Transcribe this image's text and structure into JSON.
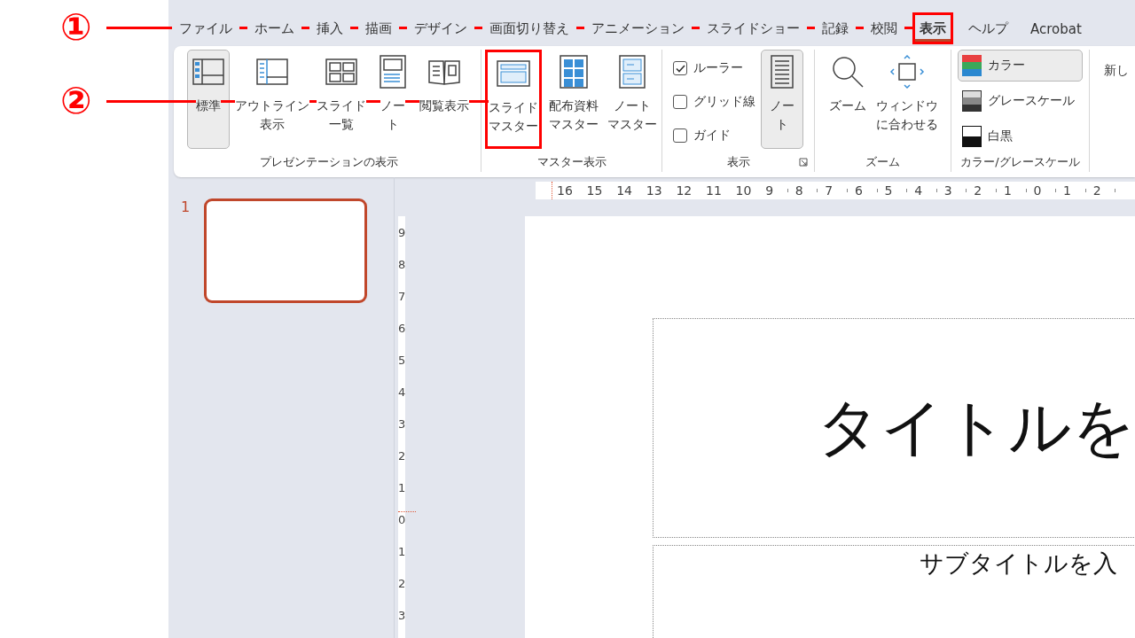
{
  "annotations": [
    {
      "label": "①"
    },
    {
      "label": "②"
    }
  ],
  "tabs": [
    {
      "label": "ファイル",
      "selected": false,
      "highlighted": false
    },
    {
      "label": "ホーム",
      "selected": false,
      "highlighted": false
    },
    {
      "label": "挿入",
      "selected": false,
      "highlighted": false
    },
    {
      "label": "描画",
      "selected": false,
      "highlighted": false
    },
    {
      "label": "デザイン",
      "selected": false,
      "highlighted": false
    },
    {
      "label": "画面切り替え",
      "selected": false,
      "highlighted": false
    },
    {
      "label": "アニメーション",
      "selected": false,
      "highlighted": false
    },
    {
      "label": "スライドショー",
      "selected": false,
      "highlighted": false
    },
    {
      "label": "記録",
      "selected": false,
      "highlighted": false
    },
    {
      "label": "校閲",
      "selected": false,
      "highlighted": false
    },
    {
      "label": "表示",
      "selected": true,
      "highlighted": true
    },
    {
      "label": "ヘルプ",
      "selected": false,
      "highlighted": false
    },
    {
      "label": "Acrobat",
      "selected": false,
      "highlighted": false
    }
  ],
  "ribbon": {
    "groups": [
      {
        "title": "プレゼンテーションの表示",
        "items": [
          {
            "kind": "large",
            "lines": [
              "標準"
            ],
            "selected": true,
            "highlighted": false
          },
          {
            "kind": "large",
            "lines": [
              "アウトライン",
              "表示"
            ],
            "selected": false,
            "highlighted": false
          },
          {
            "kind": "large",
            "lines": [
              "スライド",
              "一覧"
            ],
            "selected": false,
            "highlighted": false
          },
          {
            "kind": "large",
            "lines": [
              "ノー",
              "ト"
            ],
            "selected": false,
            "highlighted": false
          },
          {
            "kind": "large",
            "lines": [
              "閲覧表示"
            ],
            "selected": false,
            "highlighted": false
          }
        ]
      },
      {
        "title": "マスター表示",
        "items": [
          {
            "kind": "large",
            "lines": [
              "スライド",
              "マスター"
            ],
            "selected": false,
            "highlighted": true
          },
          {
            "kind": "large",
            "lines": [
              "配布資料",
              "マスター"
            ],
            "selected": false,
            "highlighted": false
          },
          {
            "kind": "large",
            "lines": [
              "ノート",
              "マスター"
            ],
            "selected": false,
            "highlighted": false
          }
        ]
      },
      {
        "title": "表示",
        "items": [
          {
            "kind": "checkbox",
            "label": "ルーラー",
            "checked": true
          },
          {
            "kind": "checkbox",
            "label": "グリッド線",
            "checked": false
          },
          {
            "kind": "checkbox",
            "label": "ガイド",
            "checked": false
          },
          {
            "kind": "large",
            "lines": [
              "ノー",
              "ト"
            ],
            "selected": true,
            "highlighted": false
          }
        ]
      },
      {
        "title": "ズーム",
        "items": [
          {
            "kind": "large",
            "lines": [
              "ズーム"
            ],
            "selected": false,
            "highlighted": false
          },
          {
            "kind": "large",
            "lines": [
              "ウィンドウ",
              "に合わせる"
            ],
            "selected": false,
            "highlighted": false
          }
        ]
      },
      {
        "title": "カラー/グレースケール",
        "items": [
          {
            "kind": "small",
            "label": "カラー",
            "selected": true
          },
          {
            "kind": "small",
            "label": "グレースケール",
            "selected": false
          },
          {
            "kind": "small",
            "label": "白黒",
            "selected": false
          }
        ]
      },
      {
        "items": [
          {
            "kind": "large",
            "lines": [
              "新し"
            ],
            "selected": false,
            "highlighted": false
          }
        ]
      }
    ]
  },
  "slides": [
    {
      "number": "1",
      "selected": true
    }
  ],
  "ruler": {
    "horizontal": [
      "16",
      "15",
      "14",
      "13",
      "12",
      "11",
      "10",
      "9",
      "8",
      "7",
      "6",
      "5",
      "4",
      "3",
      "2",
      "1",
      "0",
      "1",
      "2"
    ],
    "vertical": [
      "9",
      "8",
      "7",
      "6",
      "5",
      "4",
      "3",
      "2",
      "1",
      "0",
      "1",
      "2",
      "3"
    ]
  },
  "slide": {
    "title": "タイトルを",
    "subtitle": "サブタイトルを入"
  }
}
